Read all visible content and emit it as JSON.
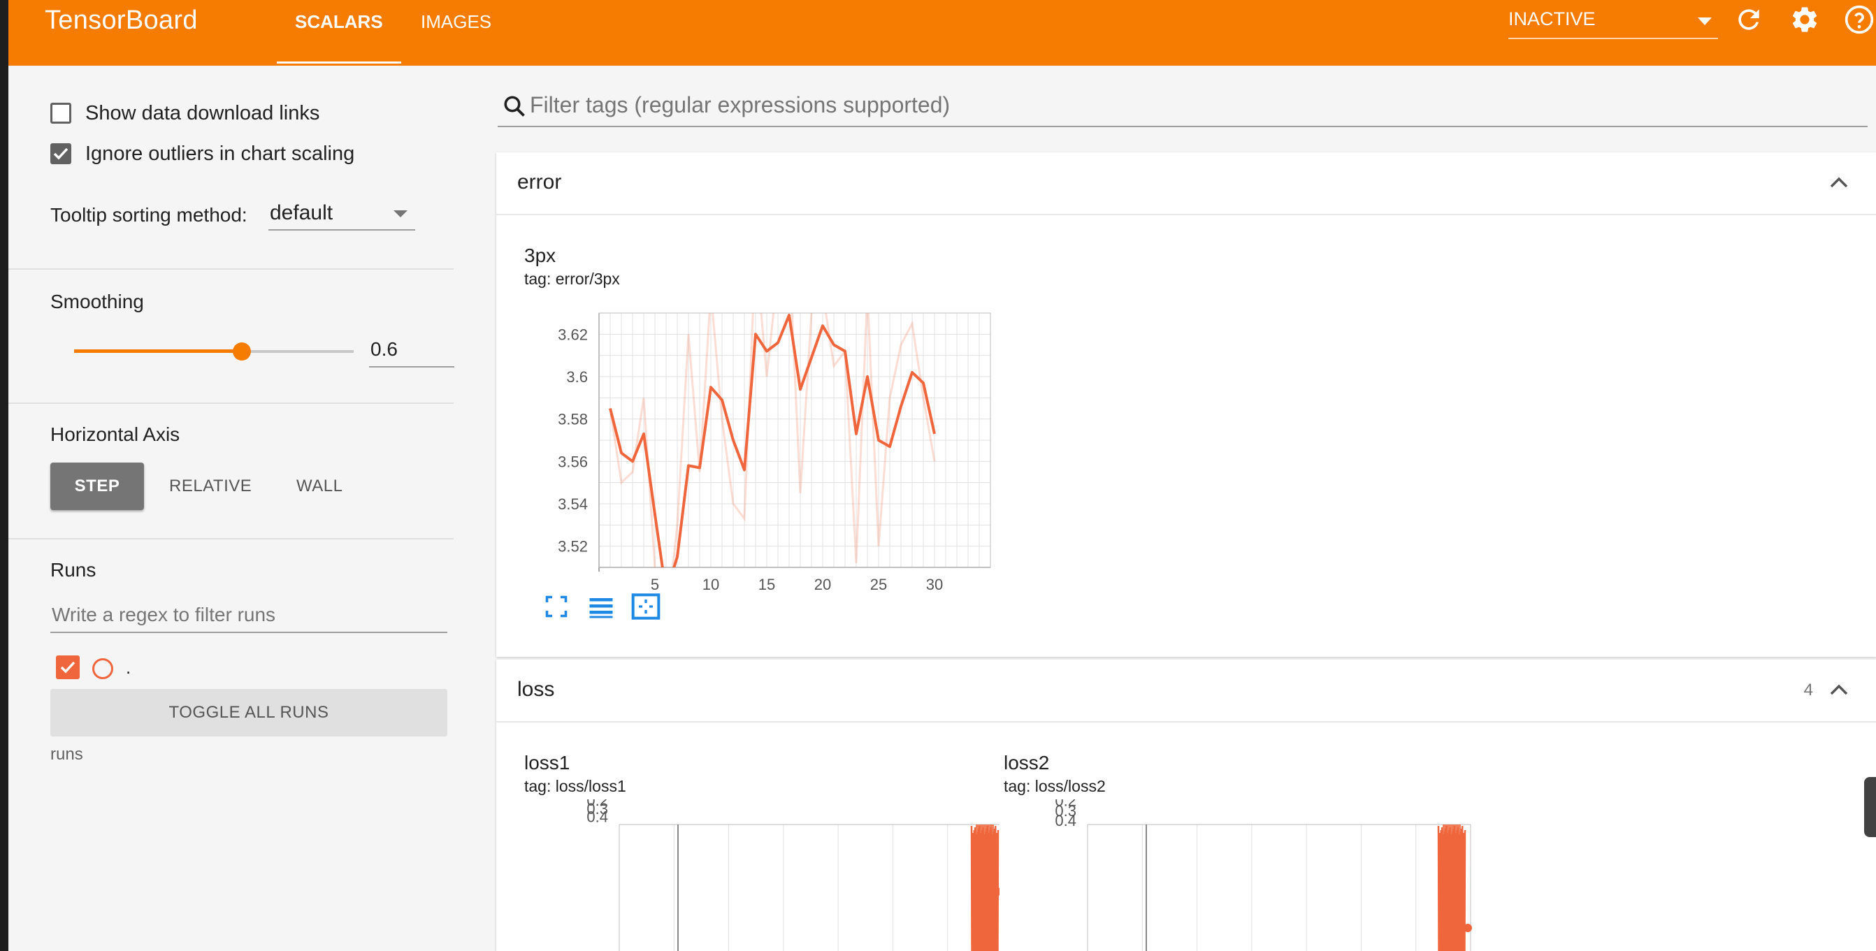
{
  "app": {
    "title": "TensorBoard",
    "tabs": [
      {
        "label": "SCALARS"
      },
      {
        "label": "IMAGES"
      }
    ],
    "status": "INACTIVE",
    "colors": {
      "toolbar": "#f57c00",
      "accent": "#f57c00",
      "series": "#f0663c"
    }
  },
  "sidebar": {
    "show_download_links": {
      "label": "Show data download links",
      "checked": false
    },
    "ignore_outliers": {
      "label": "Ignore outliers in chart scaling",
      "checked": true
    },
    "tooltip_sorting": {
      "label": "Tooltip sorting method:",
      "value": "default"
    },
    "smoothing": {
      "label": "Smoothing",
      "value": "0.6",
      "fraction": 0.6
    },
    "horizontal_axis": {
      "label": "Horizontal Axis",
      "options": [
        "STEP",
        "RELATIVE",
        "WALL"
      ],
      "selected": "STEP"
    },
    "runs": {
      "label": "Runs",
      "filter_placeholder": "Write a regex to filter runs",
      "items": [
        {
          "name": ".",
          "checked": true
        }
      ],
      "toggle_label": "TOGGLE ALL RUNS",
      "logdir": "runs"
    }
  },
  "main": {
    "filter_placeholder": "Filter tags (regular expressions supported)",
    "sections": [
      {
        "name": "error",
        "count": "",
        "charts": [
          {
            "title": "3px",
            "tag": "tag: error/3px"
          }
        ]
      },
      {
        "name": "loss",
        "count": "4",
        "charts": [
          {
            "title": "loss1",
            "tag": "tag: loss/loss1"
          },
          {
            "title": "loss2",
            "tag": "tag: loss/loss2"
          }
        ]
      }
    ]
  },
  "chart_data": [
    {
      "type": "line",
      "title": "3px",
      "xlabel": "",
      "ylabel": "",
      "x_ticks": [
        5,
        10,
        15,
        20,
        25,
        30
      ],
      "y_ticks": [
        3.52,
        3.54,
        3.56,
        3.58,
        3.6,
        3.62
      ],
      "xlim": [
        0,
        35
      ],
      "ylim": [
        3.51,
        3.63
      ],
      "grid": true,
      "series": [
        {
          "role": "smoothed",
          "x": [
            1,
            2,
            3,
            4,
            5,
            6,
            7,
            8,
            9,
            10,
            11,
            12,
            13,
            14,
            15,
            16,
            17,
            18,
            19,
            20,
            21,
            22,
            23,
            24,
            25,
            26,
            27,
            28,
            29,
            30
          ],
          "y": [
            3.585,
            3.564,
            3.56,
            3.573,
            3.535,
            3.498,
            3.515,
            3.558,
            3.557,
            3.595,
            3.589,
            3.57,
            3.556,
            3.62,
            3.612,
            3.616,
            3.629,
            3.594,
            3.609,
            3.624,
            3.615,
            3.612,
            3.573,
            3.6,
            3.57,
            3.567,
            3.586,
            3.602,
            3.597,
            3.573
          ]
        },
        {
          "role": "raw",
          "x": [
            1,
            2,
            3,
            4,
            5,
            6,
            7,
            8,
            9,
            10,
            11,
            12,
            13,
            14,
            15,
            16,
            17,
            18,
            19,
            20,
            21,
            22,
            23,
            24,
            25,
            26,
            27,
            28,
            29,
            30
          ],
          "y": [
            3.585,
            3.55,
            3.555,
            3.59,
            3.51,
            3.48,
            3.53,
            3.62,
            3.555,
            3.64,
            3.58,
            3.54,
            3.533,
            3.66,
            3.6,
            3.65,
            3.66,
            3.545,
            3.63,
            3.64,
            3.605,
            3.612,
            3.512,
            3.64,
            3.52,
            3.59,
            3.615,
            3.625,
            3.59,
            3.56
          ]
        }
      ]
    },
    {
      "type": "line",
      "title": "loss1",
      "y_ticks": [
        0.2,
        0.3,
        0.4
      ],
      "ylim": [
        0.19,
        0.5
      ],
      "grid": true
    },
    {
      "type": "line",
      "title": "loss2",
      "y_ticks": [
        0.2,
        0.3,
        0.4
      ],
      "ylim": [
        0.19,
        0.44
      ],
      "grid": true
    }
  ]
}
